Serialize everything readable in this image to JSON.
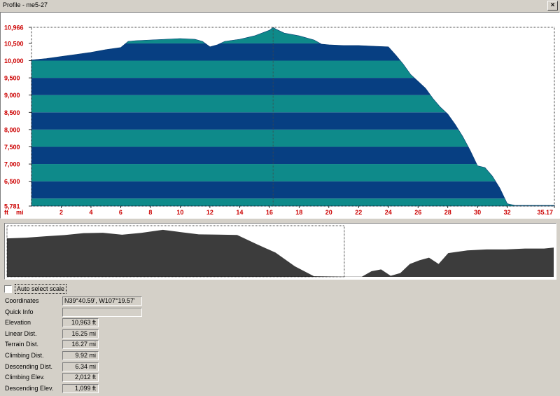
{
  "window": {
    "title": "Profile - me5-27",
    "close_glyph": "×"
  },
  "chart_data": {
    "type": "area",
    "x_unit": "mi",
    "y_unit": "ft",
    "xlim": [
      0,
      35.17
    ],
    "ylim": [
      5781,
      10966
    ],
    "x_ticks": [
      "2",
      "4",
      "6",
      "8",
      "10",
      "12",
      "14",
      "16",
      "18",
      "20",
      "22",
      "24",
      "26",
      "28",
      "30",
      "32",
      "35.17"
    ],
    "y_ticks": [
      "10,966",
      "10,500",
      "10,000",
      "9,500",
      "9,000",
      "8,500",
      "8,000",
      "7,500",
      "7,000",
      "6,500",
      "5,781"
    ],
    "band_step_ft": 500,
    "band_colors": [
      "#0e8a8a",
      "#073f82"
    ],
    "cursor_x": 16.25,
    "profile": [
      [
        0,
        10020
      ],
      [
        0.5,
        10040
      ],
      [
        1,
        10060
      ],
      [
        1.5,
        10090
      ],
      [
        2,
        10120
      ],
      [
        3,
        10180
      ],
      [
        4,
        10240
      ],
      [
        5,
        10320
      ],
      [
        6,
        10380
      ],
      [
        6.5,
        10560
      ],
      [
        7,
        10580
      ],
      [
        8,
        10600
      ],
      [
        9,
        10620
      ],
      [
        10,
        10640
      ],
      [
        11,
        10620
      ],
      [
        11.5,
        10560
      ],
      [
        12,
        10400
      ],
      [
        12.5,
        10460
      ],
      [
        13,
        10560
      ],
      [
        14,
        10620
      ],
      [
        15,
        10720
      ],
      [
        16,
        10880
      ],
      [
        16.25,
        10963
      ],
      [
        16.5,
        10900
      ],
      [
        17,
        10800
      ],
      [
        18,
        10720
      ],
      [
        19,
        10600
      ],
      [
        19.5,
        10480
      ],
      [
        20,
        10460
      ],
      [
        21,
        10440
      ],
      [
        22,
        10440
      ],
      [
        23,
        10420
      ],
      [
        24,
        10400
      ],
      [
        24.5,
        10160
      ],
      [
        25,
        9900
      ],
      [
        25.5,
        9600
      ],
      [
        26,
        9400
      ],
      [
        26.5,
        9200
      ],
      [
        27,
        8900
      ],
      [
        27.5,
        8650
      ],
      [
        28,
        8450
      ],
      [
        28.5,
        8150
      ],
      [
        29,
        7800
      ],
      [
        29.5,
        7400
      ],
      [
        30,
        6950
      ],
      [
        30.5,
        6900
      ],
      [
        31,
        6650
      ],
      [
        31.5,
        6300
      ],
      [
        32,
        5850
      ],
      [
        32.5,
        5800
      ],
      [
        35.17,
        5800
      ]
    ],
    "overview_profile": [
      [
        0,
        10020
      ],
      [
        2,
        10100
      ],
      [
        4,
        10250
      ],
      [
        6,
        10380
      ],
      [
        8,
        10600
      ],
      [
        10,
        10640
      ],
      [
        12,
        10420
      ],
      [
        14,
        10620
      ],
      [
        16.25,
        10963
      ],
      [
        18,
        10720
      ],
      [
        20,
        10460
      ],
      [
        22,
        10440
      ],
      [
        24,
        10400
      ],
      [
        26,
        9400
      ],
      [
        28,
        8450
      ],
      [
        30,
        6950
      ],
      [
        32,
        5850
      ],
      [
        35.17,
        5800
      ],
      [
        37,
        5800
      ],
      [
        38,
        6400
      ],
      [
        39,
        6600
      ],
      [
        40,
        5900
      ],
      [
        41,
        6200
      ],
      [
        42,
        7200
      ],
      [
        43,
        7600
      ],
      [
        44,
        7900
      ],
      [
        45,
        7200
      ],
      [
        46,
        8400
      ],
      [
        48,
        8700
      ],
      [
        50,
        8800
      ],
      [
        52,
        8800
      ],
      [
        54,
        8900
      ],
      [
        56,
        8900
      ],
      [
        57,
        9000
      ]
    ],
    "overview_xlim": [
      0,
      57
    ],
    "overview_ylim": [
      5781,
      10966
    ],
    "overview_window": [
      0,
      35.17
    ]
  },
  "controls": {
    "auto_select_scale": {
      "label": "Auto select scale",
      "checked": false
    }
  },
  "info": [
    {
      "label": "Coordinates",
      "value": "N39°40.59', W107°19.57'"
    },
    {
      "label": "Quick Info",
      "value": ""
    },
    {
      "label": "Elevation",
      "value": "10,963 ft"
    },
    {
      "label": "Linear Dist.",
      "value": "16.25 mi"
    },
    {
      "label": "Terrain Dist.",
      "value": "16.27 mi"
    },
    {
      "label": "Climbing Dist.",
      "value": "9.92 mi"
    },
    {
      "label": "Descending Dist.",
      "value": "6.34 mi"
    },
    {
      "label": "Climbing Elev.",
      "value": "2,012 ft"
    },
    {
      "label": "Descending Elev.",
      "value": "1,099 ft"
    }
  ]
}
